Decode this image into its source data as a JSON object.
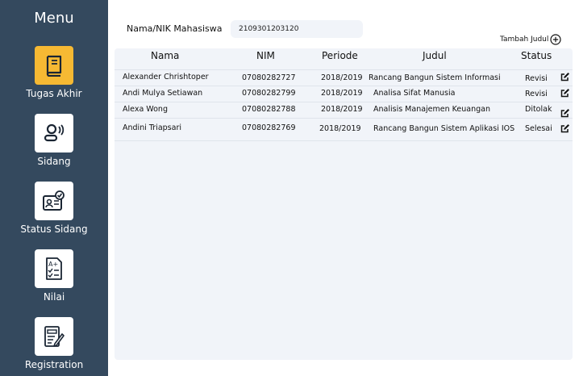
{
  "sidebar": {
    "title": "Menu",
    "items": [
      {
        "label": "Tugas Akhir",
        "icon": "book-icon",
        "active": true
      },
      {
        "label": "Sidang",
        "icon": "presenter-icon",
        "active": false
      },
      {
        "label": "Status Sidang",
        "icon": "id-card-check-icon",
        "active": false
      },
      {
        "label": "Nilai",
        "icon": "grade-sheet-icon",
        "active": false
      },
      {
        "label": "Registration",
        "icon": "form-edit-icon",
        "active": false
      }
    ]
  },
  "search": {
    "label": "Nama/NIK Mahasiswa",
    "value": "2109301203120"
  },
  "toolbar": {
    "add_label": "Tambah Judul",
    "add_icon": "plus-circle-icon"
  },
  "table": {
    "headers": {
      "nama": "Nama",
      "nim": "NIM",
      "periode": "Periode",
      "judul": "Judul",
      "status": "Status"
    },
    "rows": [
      {
        "nama": "Alexander Chrishtoper",
        "nim": "07080282727",
        "periode": "2018/2019",
        "judul": "Rancang Bangun Sistem Informasi",
        "status": "Revisi"
      },
      {
        "nama": "Andi Mulya Setiawan",
        "nim": "07080282799",
        "periode": "2018/2019",
        "judul": "Analisa Sifat Manusia",
        "status": "Revisi"
      },
      {
        "nama": "Alexa Wong",
        "nim": "07080282788",
        "periode": "2018/2019",
        "judul": "Analisis Manajemen Keuangan",
        "status": "Ditolak"
      },
      {
        "nama": "Andini Triapsari",
        "nim": "07080282769",
        "periode": "2018/2019",
        "judul": "Rancang Bangun Sistem Aplikasi IOS",
        "status": "Selesai"
      }
    ]
  },
  "colors": {
    "sidebar_bg": "#34495e",
    "active_tile": "#f6b933",
    "panel_bg": "#f1f4f9"
  }
}
